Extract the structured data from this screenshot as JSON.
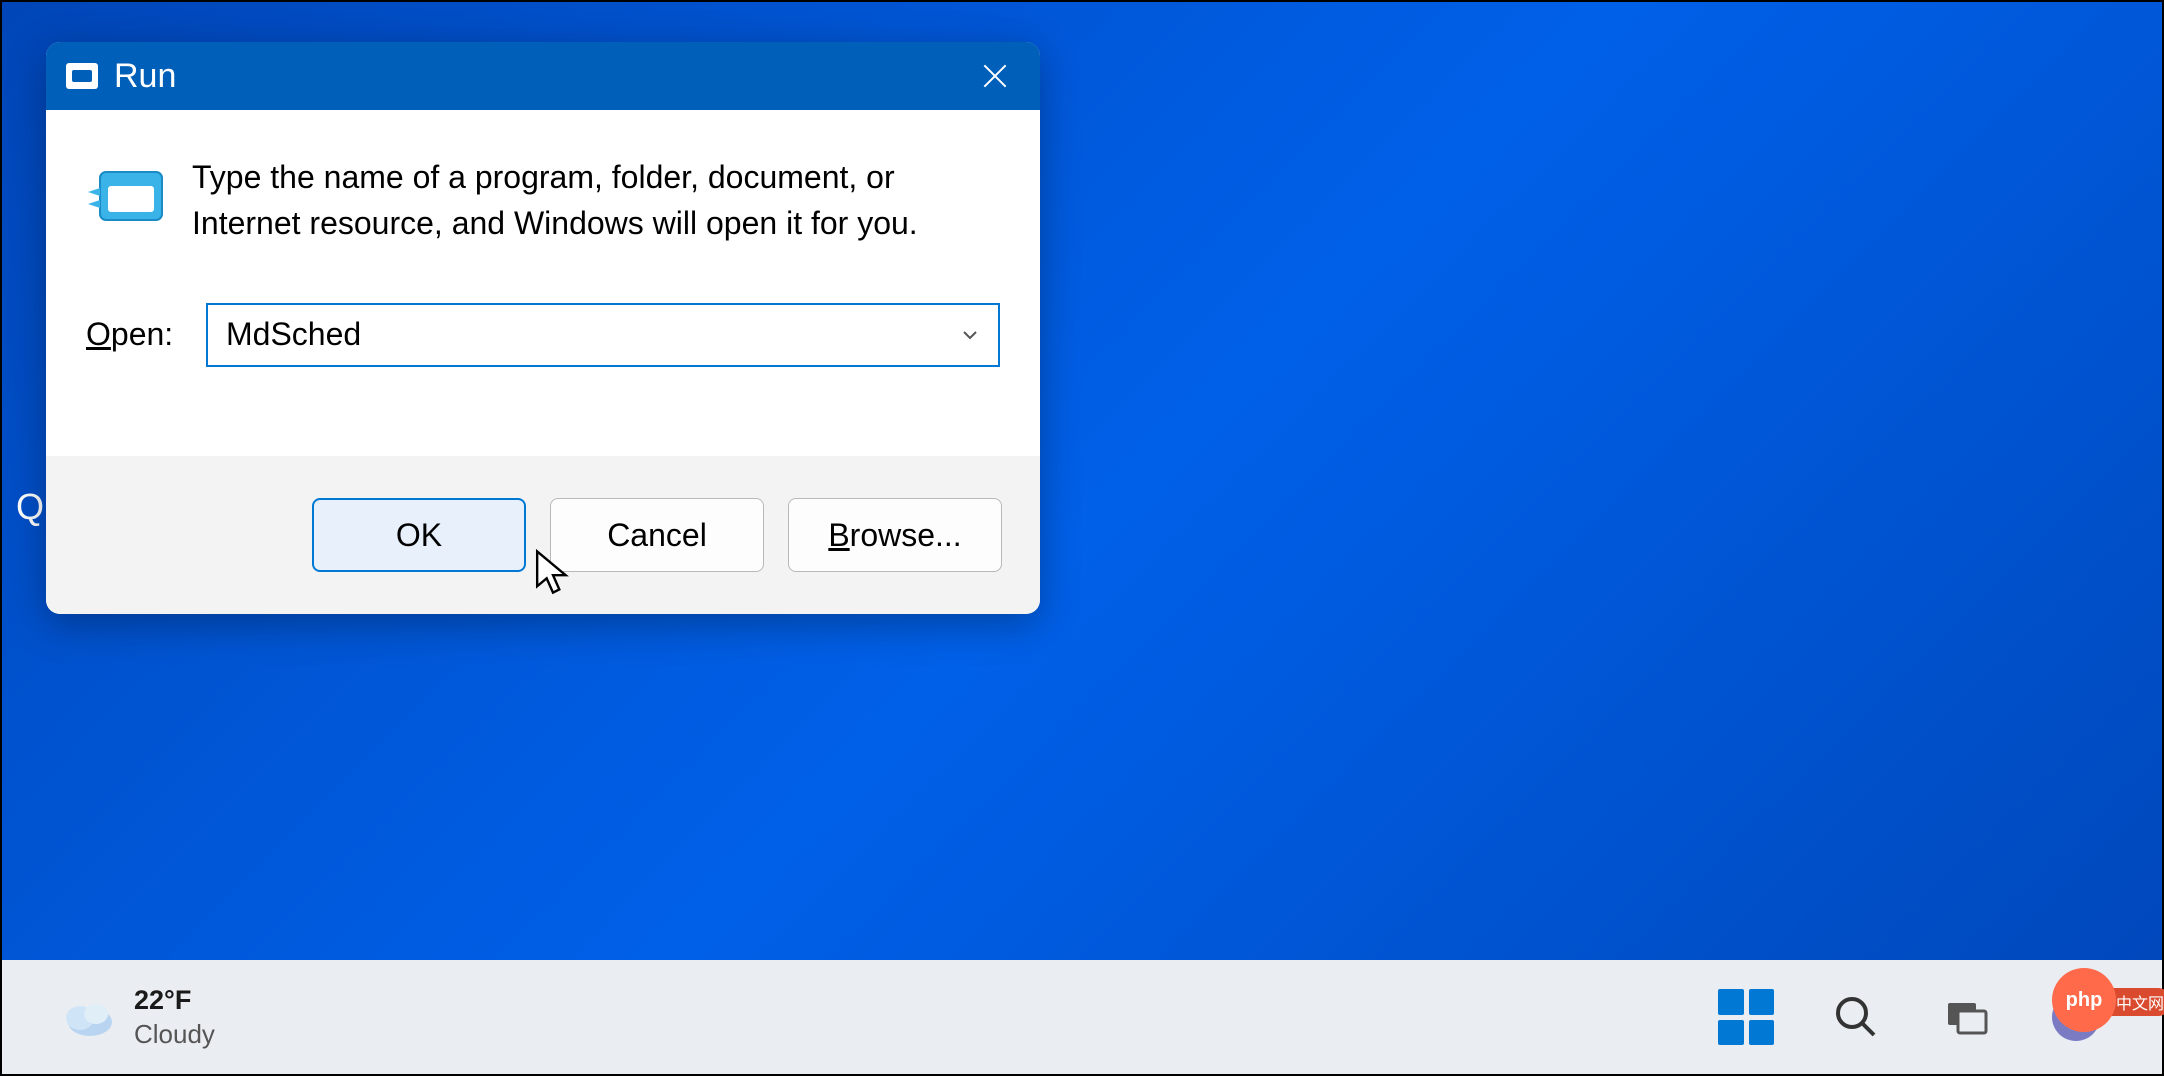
{
  "desktop": {
    "partial_text": "Q"
  },
  "run_dialog": {
    "title": "Run",
    "description": "Type the name of a program, folder, document, or Internet resource, and Windows will open it for you.",
    "open_label_prefix": "O",
    "open_label_rest": "pen:",
    "input_value": "MdSched",
    "buttons": {
      "ok": "OK",
      "cancel": "Cancel",
      "browse_prefix": "B",
      "browse_rest": "rowse..."
    }
  },
  "taskbar": {
    "weather": {
      "temperature": "22°F",
      "condition": "Cloudy"
    }
  },
  "watermark": {
    "logo_text": "php",
    "tail_text": "中文网"
  }
}
